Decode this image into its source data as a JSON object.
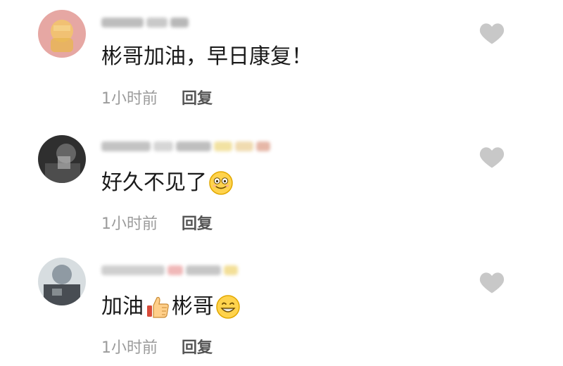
{
  "comments": [
    {
      "text": "彬哥加油，早日康复！",
      "time": "1小时前",
      "reply_label": "回复",
      "avatar_color": "#e8a3a0"
    },
    {
      "text": "好久不见了",
      "emoji": "smiling-face-icon",
      "time": "1小时前",
      "reply_label": "回复",
      "avatar_color": "#3b3b3b"
    },
    {
      "text_before": "加油",
      "thumb": "thumbs-up-icon",
      "text_after": "彬哥",
      "emoji": "grinning-face-icon",
      "time": "1小时前",
      "reply_label": "回复",
      "avatar_color": "#6e7c86"
    }
  ],
  "colors": {
    "like_icon": "#c8c8c8",
    "meta_text": "#9b9b9b",
    "reply_text": "#555555"
  }
}
